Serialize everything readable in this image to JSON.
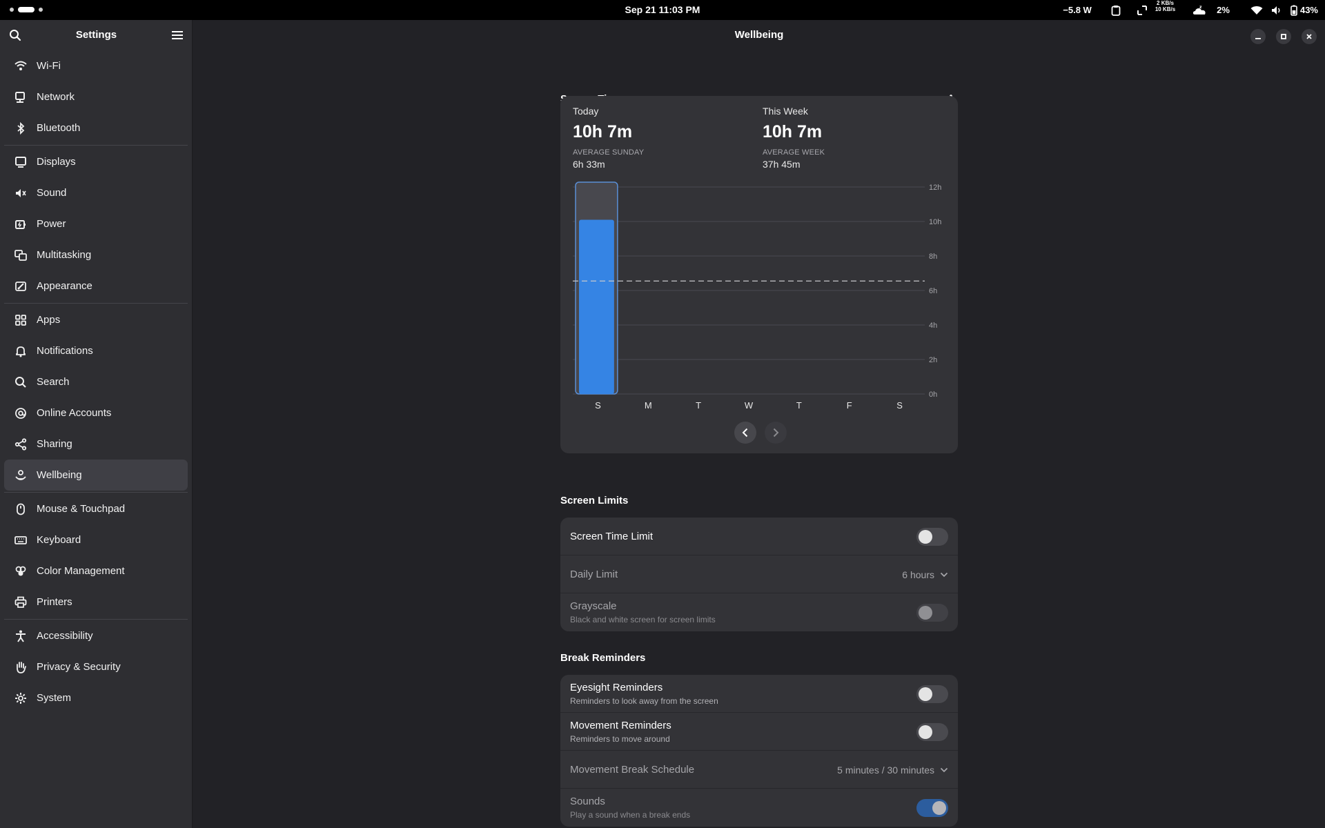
{
  "topbar": {
    "datetime": "Sep 21  11:03 PM",
    "power": "−5.8 W",
    "net_up": "2 KB/s",
    "net_down": "10 KB/s",
    "weather_pct": "2%",
    "battery": "43%"
  },
  "sidebar": {
    "title": "Settings",
    "groups": [
      [
        {
          "label": "Wi-Fi",
          "icon": "wifi-icon"
        },
        {
          "label": "Network",
          "icon": "network-icon"
        },
        {
          "label": "Bluetooth",
          "icon": "bluetooth-icon"
        }
      ],
      [
        {
          "label": "Displays",
          "icon": "display-icon"
        },
        {
          "label": "Sound",
          "icon": "speaker-icon"
        },
        {
          "label": "Power",
          "icon": "power-icon"
        },
        {
          "label": "Multitasking",
          "icon": "multitasking-icon"
        },
        {
          "label": "Appearance",
          "icon": "appearance-icon"
        }
      ],
      [
        {
          "label": "Apps",
          "icon": "apps-grid-icon"
        },
        {
          "label": "Notifications",
          "icon": "bell-icon"
        },
        {
          "label": "Search",
          "icon": "search-icon"
        },
        {
          "label": "Online Accounts",
          "icon": "at-sign-icon"
        },
        {
          "label": "Sharing",
          "icon": "share-icon"
        },
        {
          "label": "Wellbeing",
          "icon": "wellbeing-icon",
          "active": true
        }
      ],
      [
        {
          "label": "Mouse & Touchpad",
          "icon": "mouse-icon"
        },
        {
          "label": "Keyboard",
          "icon": "keyboard-icon"
        },
        {
          "label": "Color Management",
          "icon": "color-management-icon"
        },
        {
          "label": "Printers",
          "icon": "printer-icon"
        }
      ],
      [
        {
          "label": "Accessibility",
          "icon": "accessibility-icon"
        },
        {
          "label": "Privacy & Security",
          "icon": "hand-icon"
        },
        {
          "label": "System",
          "icon": "gear-icon"
        }
      ]
    ]
  },
  "main": {
    "title": "Wellbeing"
  },
  "screen_time": {
    "section_title": "Screen Time",
    "today_label": "Today",
    "today_value": "10h 7m",
    "today_avg_caption": "AVERAGE SUNDAY",
    "today_avg_value": "6h 33m",
    "week_label": "This Week",
    "week_value": "10h 7m",
    "week_avg_caption": "AVERAGE WEEK",
    "week_avg_value": "37h 45m"
  },
  "chart_data": {
    "type": "bar",
    "categories": [
      "S",
      "M",
      "T",
      "W",
      "T",
      "F",
      "S"
    ],
    "values": [
      10.1,
      0,
      0,
      0,
      0,
      0,
      0
    ],
    "y_ticks": [
      "0h",
      "2h",
      "4h",
      "6h",
      "8h",
      "10h",
      "12h"
    ],
    "ylim": [
      0,
      12
    ],
    "average_line": 6.55,
    "selected_index": 0,
    "bar_color": "#3584e4",
    "grid": true
  },
  "screen_limits": {
    "section_title": "Screen Limits",
    "limit_title": "Screen Time Limit",
    "daily_limit_title": "Daily Limit",
    "daily_limit_value": "6 hours",
    "grayscale_title": "Grayscale",
    "grayscale_sub": "Black and white screen for screen limits"
  },
  "break_reminders": {
    "section_title": "Break Reminders",
    "eyesight_title": "Eyesight Reminders",
    "eyesight_sub": "Reminders to look away from the screen",
    "movement_title": "Movement Reminders",
    "movement_sub": "Reminders to move around",
    "schedule_title": "Movement Break Schedule",
    "schedule_value": "5 minutes / 30 minutes",
    "sounds_title": "Sounds",
    "sounds_sub": "Play a sound when a break ends"
  }
}
